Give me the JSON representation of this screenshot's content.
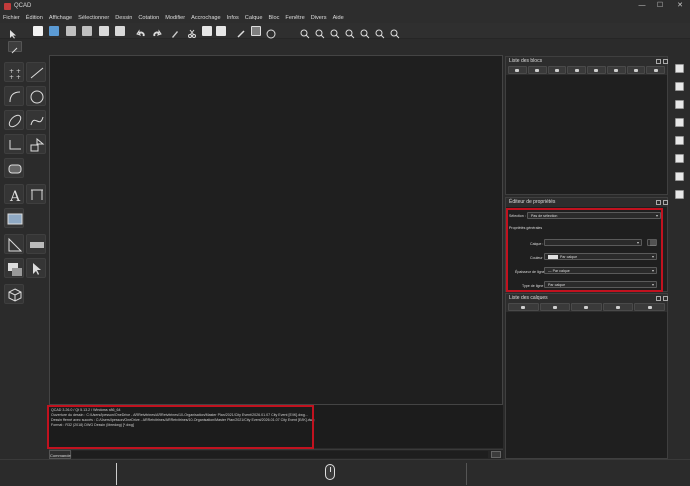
{
  "window": {
    "title": "QCAD",
    "controls": [
      "—",
      "☐",
      "✕"
    ]
  },
  "menu": {
    "items": [
      "Fichier",
      "Édition",
      "Affichage",
      "Sélectionner",
      "Dessin",
      "Cotation",
      "Modifier",
      "Accrochage",
      "Infos",
      "Calque",
      "Bloc",
      "Fenêtre",
      "Divers",
      "Aide"
    ]
  },
  "toolbar": {
    "icons": [
      "pointer-icon",
      "new-icon",
      "open-icon",
      "save-icon",
      "save-as-icon",
      "print-preview-icon",
      "print-icon",
      "undo-icon",
      "redo-icon",
      "pen-icon",
      "cut-icon",
      "copy-icon",
      "paste-icon",
      "pencil-icon",
      "image-icon",
      "circle-icon",
      "zoom-in-icon",
      "zoom-out-icon",
      "zoom-icon",
      "zoom-window-icon",
      "zoom-fit-icon",
      "zoom-previous-icon",
      "zoom-selection-icon"
    ]
  },
  "blocks_panel": {
    "title": "Liste des blocs"
  },
  "properties_panel": {
    "title": "Éditeur de propriétés",
    "selection_label": "Sélection :",
    "selection_value": "Pas de sélection",
    "section_label": "Propriétés générales",
    "fields": [
      {
        "label": "Calque :",
        "value": ""
      },
      {
        "label": "Couleur :",
        "value": "Par calque"
      },
      {
        "label": "Épaisseur de ligne :",
        "value": "— Par calque"
      },
      {
        "label": "Type de ligne :",
        "value": "Par calque"
      }
    ]
  },
  "layers_panel": {
    "title": "Liste des calques"
  },
  "command_history": {
    "lines": [
      "QCAD 3.26.0 / Qt 5.13.2 / Windows x86_64",
      "Ouverture du dessin : C:/Users/Ipesson/OneDrive - ARRetvitrines/ARRetvitrines/10-Organisation/Master Plan/2021/City Event/2026.01.07 City Event [E/IK].dwg...",
      "Dessin fferné avec succès : C:/Users/Ipesson/OneDrive - ARRetvitrines/ARRetvitrines/10-Organisation/Master Plan/2021/City Event/2026.01.07 City Event [E/IK].dwg",
      "Format : R32 (2018) DWG Dessin (libredwg) [*.dwg]"
    ]
  },
  "command_line": {
    "label": "Commande :"
  },
  "colors": {
    "highlight": "#c1121f",
    "background": "#2b2b2b",
    "canvas": "#1f1f1f"
  }
}
